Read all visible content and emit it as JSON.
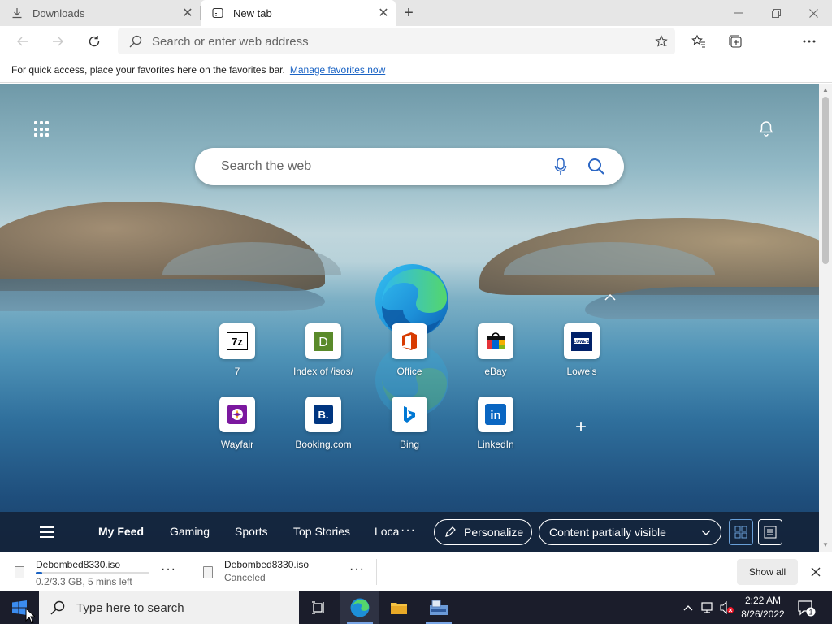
{
  "tabs": [
    {
      "label": "Downloads",
      "icon": "download-icon"
    },
    {
      "label": "New tab",
      "icon": "newtab-page-icon"
    }
  ],
  "toolbar": {
    "address_placeholder": "Search or enter web address"
  },
  "favorites_bar": {
    "message": "For quick access, place your favorites here on the favorites bar.",
    "link": "Manage favorites now"
  },
  "newtab": {
    "search_placeholder": "Search the web",
    "quick_links": [
      {
        "name": "7",
        "icon": "7zip-icon",
        "color": "#000000"
      },
      {
        "name": "Index of /isos/",
        "icon": "letter-d-icon",
        "color": "#5a8a2a"
      },
      {
        "name": "Office",
        "icon": "office-icon",
        "color": "#d83b01"
      },
      {
        "name": "eBay",
        "icon": "ebay-icon",
        "color": "#e53238"
      },
      {
        "name": "Lowe's",
        "icon": "lowes-icon",
        "color": "#012169"
      },
      {
        "name": "Wayfair",
        "icon": "wayfair-icon",
        "color": "#7b189f"
      },
      {
        "name": "Booking.com",
        "icon": "booking-icon",
        "color": "#003580"
      },
      {
        "name": "Bing",
        "icon": "bing-icon",
        "color": "#0078d4"
      },
      {
        "name": "LinkedIn",
        "icon": "linkedin-icon",
        "color": "#0a66c2"
      }
    ],
    "tile_text": {
      "7zip": "7z",
      "index": "D",
      "booking": "B.",
      "linkedin": "in",
      "lowes": "LOWE'S"
    },
    "add_tile": "+"
  },
  "feed": {
    "items": [
      "My Feed",
      "Gaming",
      "Sports",
      "Top Stories",
      "Loca"
    ],
    "active": "My Feed",
    "more": "···",
    "personalize": "Personalize",
    "visibility": "Content partially visible"
  },
  "downloads": [
    {
      "filename": "Debombed8330.iso",
      "status": "0.2/3.3 GB, 5 mins left",
      "progress_fraction": 0.06
    },
    {
      "filename": "Debombed8330.iso",
      "status": "Canceled"
    }
  ],
  "download_more": "···",
  "show_all": "Show all",
  "taskbar": {
    "search_placeholder": "Type here to search",
    "time": "2:22 AM",
    "date": "8/26/2022",
    "notification_count": "1"
  },
  "colors": {
    "accent": "#1a63c4",
    "taskbar": "#1b1d2b",
    "feedbar": "#142238"
  }
}
